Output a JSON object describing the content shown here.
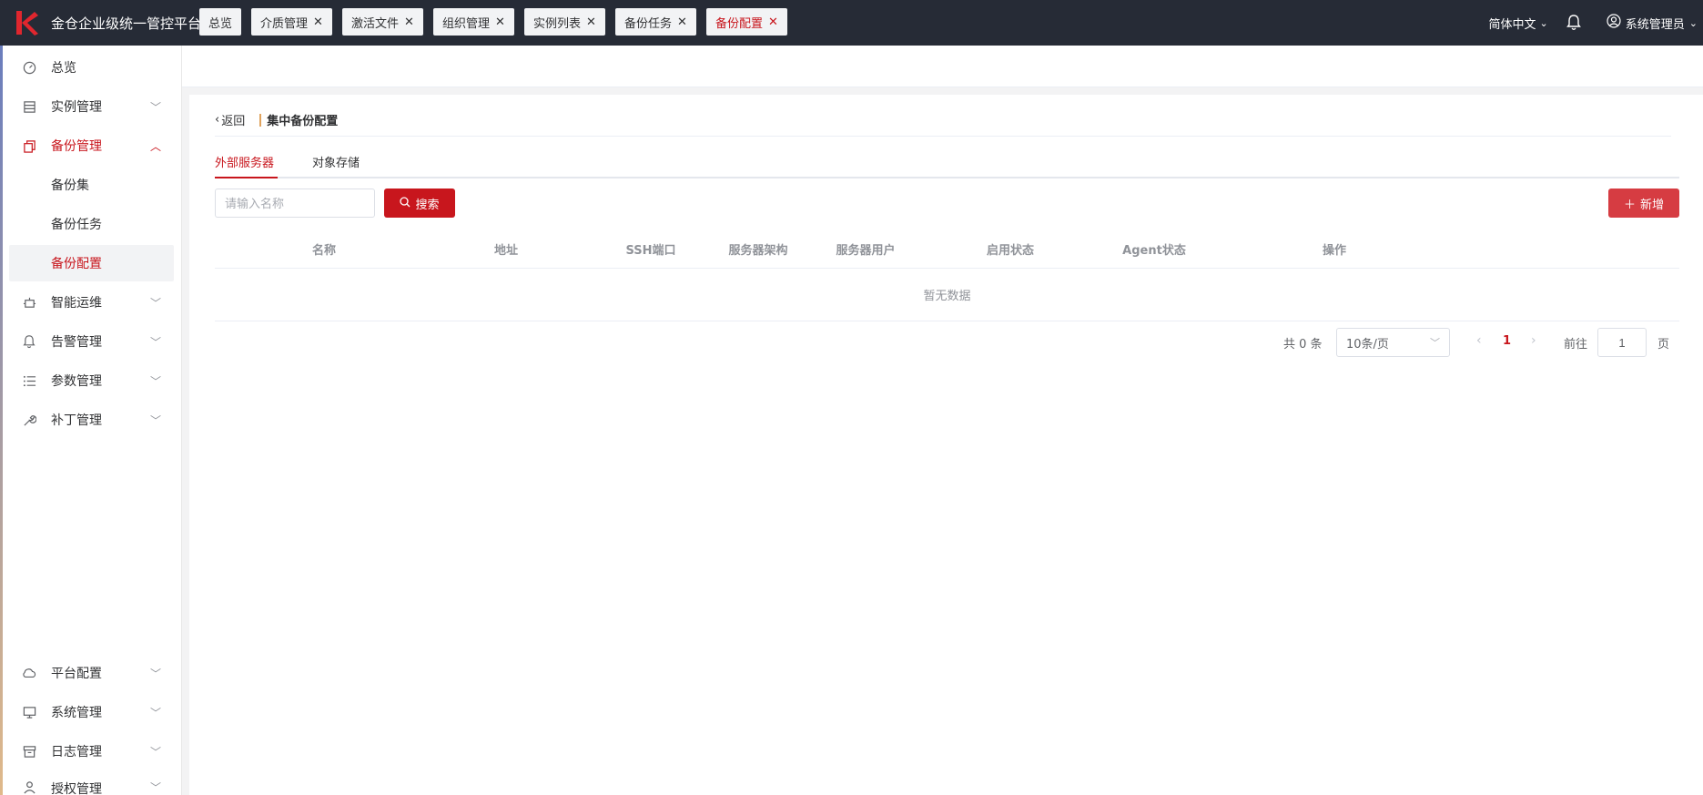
{
  "header": {
    "app_title": "金仓企业级统一管控平台",
    "language": "简体中文",
    "user": "系统管理员"
  },
  "sidebar": {
    "items": [
      {
        "label": "总览",
        "icon": "dashboard-icon"
      },
      {
        "label": "实例管理",
        "icon": "list-icon"
      },
      {
        "label": "备份管理",
        "icon": "copy-icon",
        "expanded": true,
        "children": [
          {
            "label": "备份集"
          },
          {
            "label": "备份任务"
          },
          {
            "label": "备份配置",
            "active": true
          }
        ]
      },
      {
        "label": "智能运维",
        "icon": "robot-icon"
      },
      {
        "label": "告警管理",
        "icon": "bell-icon"
      },
      {
        "label": "参数管理",
        "icon": "list-bullets-icon"
      },
      {
        "label": "补丁管理",
        "icon": "wrench-icon"
      },
      {
        "label": "平台配置",
        "icon": "cloud-icon"
      },
      {
        "label": "系统管理",
        "icon": "monitor-icon"
      },
      {
        "label": "日志管理",
        "icon": "archive-icon"
      },
      {
        "label": "授权管理",
        "icon": "user-icon"
      }
    ]
  },
  "tabs": [
    {
      "label": "总览",
      "closable": false
    },
    {
      "label": "介质管理",
      "closable": true
    },
    {
      "label": "激活文件",
      "closable": true
    },
    {
      "label": "组织管理",
      "closable": true
    },
    {
      "label": "实例列表",
      "closable": true
    },
    {
      "label": "备份任务",
      "closable": true
    },
    {
      "label": "备份配置",
      "closable": true,
      "active": true
    }
  ],
  "page": {
    "back_label": "返回",
    "title": "集中备份配置",
    "subtabs": [
      {
        "label": "外部服务器",
        "active": true
      },
      {
        "label": "对象存储"
      }
    ],
    "search_placeholder": "请输入名称",
    "search_button": "搜索",
    "add_button": "新增",
    "table": {
      "columns": [
        "名称",
        "地址",
        "SSH端口",
        "服务器架构",
        "服务器用户",
        "启用状态",
        "Agent状态",
        "操作"
      ],
      "empty_text": "暂无数据"
    },
    "pagination": {
      "total_text": "共 0 条",
      "page_size": "10条/页",
      "current_page": "1",
      "goto_label": "前往",
      "goto_value": "1",
      "page_suffix": "页"
    }
  },
  "colors": {
    "brand": "#c8161d",
    "header_bg": "#262b36"
  }
}
